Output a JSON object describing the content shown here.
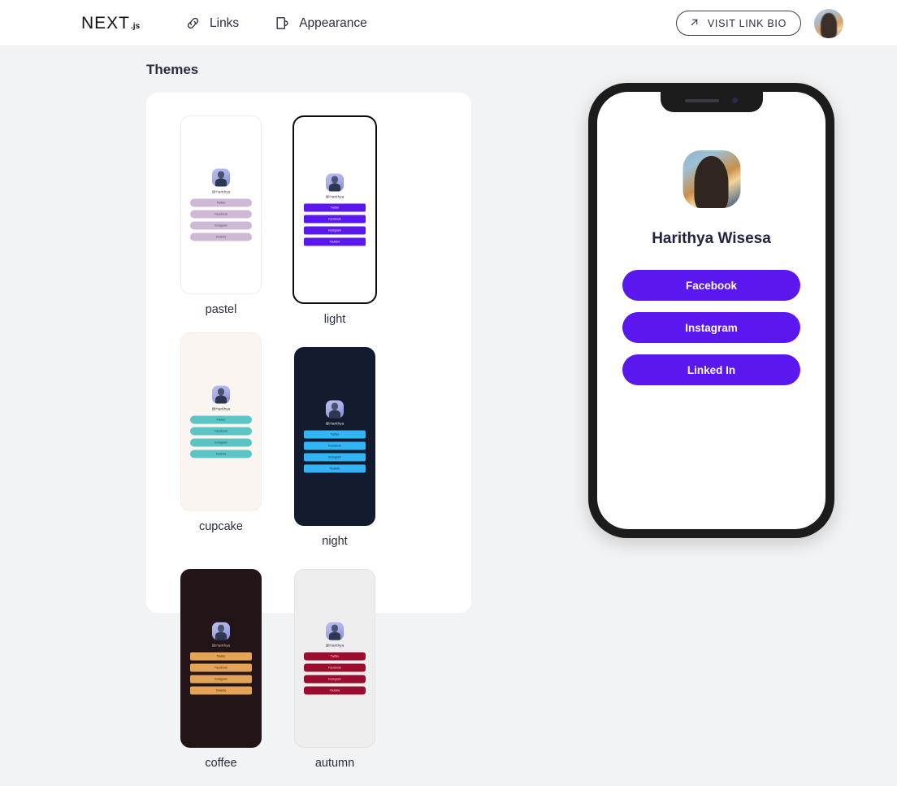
{
  "top_cut_card": {
    "present": true
  },
  "navbar": {
    "brand": {
      "main": "NEXT",
      "suffix": ".js"
    },
    "items": [
      {
        "label": "Links",
        "icon": "link-icon"
      },
      {
        "label": "Appearance",
        "icon": "palette-icon"
      }
    ],
    "visit_button": {
      "label": "VISIT LINK BIO",
      "icon": "arrow-up-right-icon"
    },
    "avatar": {
      "alt": "user-avatar"
    }
  },
  "page": {
    "title": "Themes"
  },
  "themes": [
    {
      "name": "pastel",
      "selected": false,
      "bg": "#ffffff",
      "border": "#e9ecef",
      "button_bg": "#cdb9d6",
      "button_text": "#4b3a52",
      "handle_color": "#4b3a52",
      "handle": "@Harithya",
      "links": [
        "Twitter",
        "Facebook",
        "Instagram",
        "Youtube"
      ],
      "button_radius": "5px"
    },
    {
      "name": "light",
      "selected": true,
      "bg": "#ffffff",
      "border": "#0b0b0b",
      "button_bg": "#5b17ef",
      "button_text": "#ffffff",
      "handle_color": "#2b2d42",
      "handle": "@Harithya",
      "links": [
        "Twitter",
        "Facebook",
        "Instagram",
        "Youtube"
      ],
      "button_radius": "2px"
    },
    {
      "name": "cupcake",
      "selected": false,
      "bg": "#faf5f1",
      "border": "#f4ece5",
      "button_bg": "#5bc5c5",
      "button_text": "#10494d",
      "handle_color": "#3a3340",
      "handle": "@Harithya",
      "links": [
        "Twitter",
        "Facebook",
        "Instagram",
        "Youtube"
      ],
      "button_radius": "6px"
    },
    {
      "name": "night",
      "selected": false,
      "bg": "#131c2e",
      "border": "#131c2e",
      "button_bg": "#33b5f5",
      "button_text": "#0a2233",
      "handle_color": "#e8edf5",
      "handle": "@Harithya",
      "links": [
        "Twitter",
        "Facebook",
        "Instagram",
        "Youtube"
      ],
      "button_radius": "2px"
    },
    {
      "name": "coffee",
      "selected": false,
      "bg": "#231417",
      "border": "#231417",
      "button_bg": "#e3a455",
      "button_text": "#3a2410",
      "handle_color": "#cfc3bd",
      "handle": "@Harithya",
      "links": [
        "Twitter",
        "Facebook",
        "Instagram",
        "Youtube"
      ],
      "button_radius": "2px"
    },
    {
      "name": "autumn",
      "selected": false,
      "bg": "#eeeeee",
      "border": "#e4e4e4",
      "button_bg": "#9b0c2e",
      "button_text": "#f4dfe2",
      "handle_color": "#2b2d42",
      "handle": "@Harithya",
      "links": [
        "Twitter",
        "Facebook",
        "Instagram",
        "Youtube"
      ],
      "button_radius": "3px"
    }
  ],
  "preview": {
    "display_name": "Harithya Wisesa",
    "avatar_alt": "profile-photo",
    "accent_color": "#5b17ef",
    "links": [
      {
        "label": "Facebook"
      },
      {
        "label": "Instagram"
      },
      {
        "label": "Linked In"
      }
    ]
  }
}
